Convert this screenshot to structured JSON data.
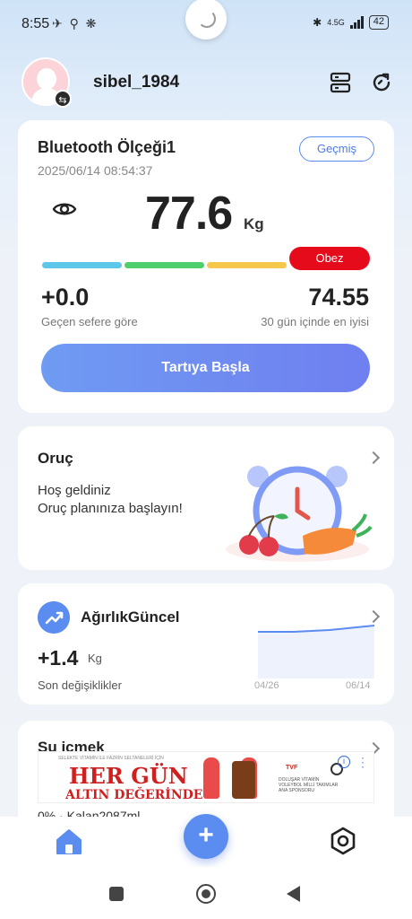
{
  "status_bar": {
    "time": "8:55",
    "left_icons": "✈ ⚲ ❋",
    "network": "4.5G",
    "battery": "42"
  },
  "header": {
    "username": "sibel_1984"
  },
  "scale_card": {
    "device_name": "Bluetooth Ölçeği1",
    "timestamp": "2025/06/14 08:54:37",
    "history_label": "Geçmiş",
    "weight": "77.6",
    "unit": "Kg",
    "bmi_category": "Obez",
    "difference": "+0.0",
    "difference_label": "Geçen sefere göre",
    "best": "74.55",
    "best_label": "30 gün içinde en iyisi",
    "start_button": "Tartıya Başla",
    "bmi_colors": [
      "#5cc7e8",
      "#4fcf6c",
      "#f5c84c",
      "#e50b1b"
    ]
  },
  "fasting_card": {
    "title": "Oruç",
    "line1": "Hoş geldiniz",
    "line2": "Oruç planınıza başlayın!"
  },
  "trend_card": {
    "title": "AğırlıkGüncel",
    "value": "+1.4",
    "unit": "Kg",
    "label": "Son değişiklikler",
    "start_date": "04/26",
    "end_date": "06/14"
  },
  "water_card": {
    "title": "Su içmek",
    "status": "0% · Kalan2087ml",
    "ad": {
      "headline_top": "SELEKTE VİTAMİN İLE FAZRİN SELTANELERİ İÇİN",
      "headline_1": "HER GÜN",
      "headline_2": "ALTIN DEĞERİNDE",
      "tvf": "TVF",
      "side_text": "DOLUŞAR VİTAMİN VOLEYBOL MİLLİ TAKIMLAR ANA SPONSORU"
    }
  },
  "bottom_nav": {
    "add": "+"
  }
}
